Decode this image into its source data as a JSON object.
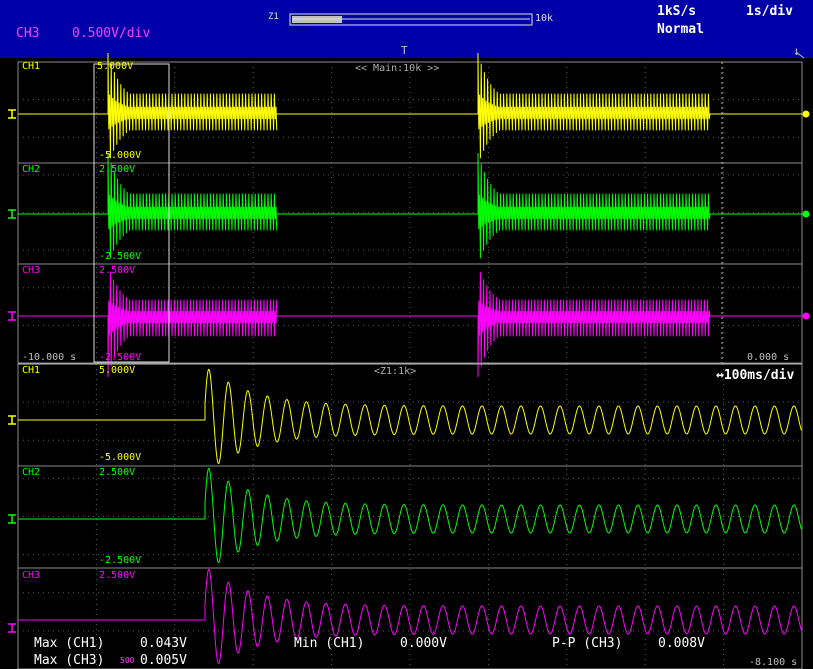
{
  "header": {
    "channel": "CH3",
    "vdiv": "0.500V/div",
    "sample_rate": "1kS/s",
    "time_div": "1s/div",
    "trigger_mode": "Normal",
    "zoom_label": "Z1",
    "record_length": "10k",
    "trigger_marker": "T",
    "down_arrow": "↓"
  },
  "main": {
    "label": "<< Main:10k >>",
    "time_left": "-10.000 s",
    "time_right": "0.000 s",
    "channels": [
      {
        "name": "CH1",
        "top": "5.000V",
        "bottom": "-5.000V",
        "color": "#ffff00"
      },
      {
        "name": "CH2",
        "top": "2.500V",
        "bottom": "-2.500V",
        "color": "#00ff00"
      },
      {
        "name": "CH3",
        "top": "2.500V",
        "bottom": "-2.500V",
        "color": "#ff00ff"
      }
    ]
  },
  "zoom": {
    "label": "<Z1:1k>",
    "timebase": "↔100ms/div",
    "time_right": "-8.100 s",
    "channels": [
      {
        "name": "CH1",
        "top": "5.000V",
        "bottom": "-5.000V",
        "color": "#ffff00"
      },
      {
        "name": "CH2",
        "top": "2.500V",
        "bottom": "-2.500V",
        "color": "#00ff00"
      },
      {
        "name": "CH3",
        "top": "2.500V",
        "bottom": "",
        "color": "#ff00ff"
      }
    ]
  },
  "measurements": [
    {
      "label": "Max (CH1)",
      "value": "0.043V"
    },
    {
      "label": "Min (CH1)",
      "value": "0.000V"
    },
    {
      "label": "P-P (CH3)",
      "value": "0.008V"
    },
    {
      "label": "Max (CH3)",
      "value": "0.005V"
    }
  ],
  "partial_label": "500",
  "colors": {
    "background": "#000000",
    "header": "#0000a8",
    "grid": "#5a5a5a",
    "ch1": "#ffff00",
    "ch2": "#00ff00",
    "ch3": "#ff00ff"
  }
}
